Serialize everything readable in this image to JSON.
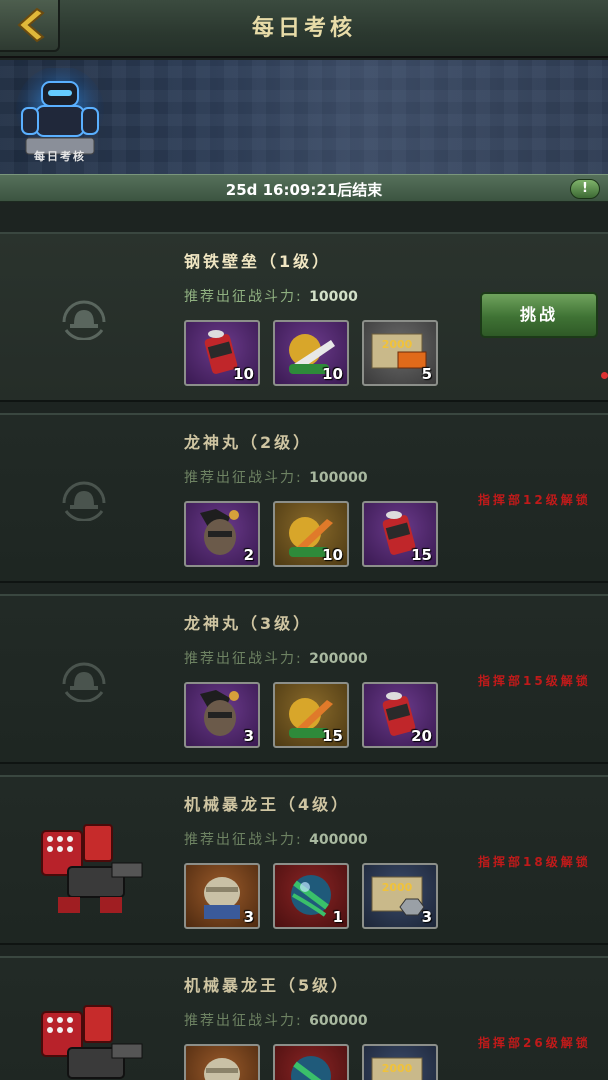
{
  "header": {
    "title": "每日考核",
    "back_icon": "back-arrow-icon"
  },
  "banner": {
    "label": "每日考核",
    "icon": "robot-mascot-icon"
  },
  "timer": {
    "text": "25d 16:09:21后结束",
    "info_label": "!"
  },
  "levels": [
    {
      "name": "钢铁壁垒（1级）",
      "power_label": "推荐出征战斗力:",
      "power": "10000",
      "state": "unlocked",
      "action_label": "挑战",
      "rewards": [
        {
          "icon": "red-canister-icon",
          "count": "10"
        },
        {
          "icon": "missile-shell-icon",
          "count": "10"
        },
        {
          "icon": "brick-crate-2000-icon",
          "count": "5"
        }
      ]
    },
    {
      "name": "龙神丸（2级）",
      "power_label": "推荐出征战斗力:",
      "power": "100000",
      "state": "locked",
      "lock_text": "指挥部12级解锁",
      "rewards": [
        {
          "icon": "hero-portrait-puzzle-icon",
          "count": "2"
        },
        {
          "icon": "missile-shell-icon",
          "count": "10"
        },
        {
          "icon": "red-canister-icon",
          "count": "15"
        }
      ]
    },
    {
      "name": "龙神丸（3级）",
      "power_label": "推荐出征战斗力:",
      "power": "200000",
      "state": "locked",
      "lock_text": "指挥部15级解锁",
      "rewards": [
        {
          "icon": "hero-portrait-puzzle-icon",
          "count": "3"
        },
        {
          "icon": "missile-shell-icon",
          "count": "15"
        },
        {
          "icon": "red-canister-icon",
          "count": "20"
        }
      ]
    },
    {
      "name": "机械暴龙王（4级）",
      "power_label": "推荐出征战斗力:",
      "power": "400000",
      "state": "locked",
      "lock_text": "指挥部18级解锁",
      "rewards": [
        {
          "icon": "mummy-portrait-puzzle-icon",
          "count": "3"
        },
        {
          "icon": "striped-orb-icon",
          "count": "1"
        },
        {
          "icon": "steel-crate-2000-icon",
          "count": "3"
        }
      ]
    },
    {
      "name": "机械暴龙王（5级）",
      "power_label": "推荐出征战斗力:",
      "power": "600000",
      "state": "locked",
      "lock_text": "指挥部26级解锁",
      "rewards": [
        {
          "icon": "mummy-portrait-puzzle-icon",
          "count": ""
        },
        {
          "icon": "striped-orb-icon",
          "count": ""
        },
        {
          "icon": "steel-crate-2000-icon",
          "count": ""
        }
      ]
    }
  ],
  "colors": {
    "accent_gold": "#e8dca8",
    "lock_red": "#c01a1a",
    "button_green": "#3f7234"
  }
}
